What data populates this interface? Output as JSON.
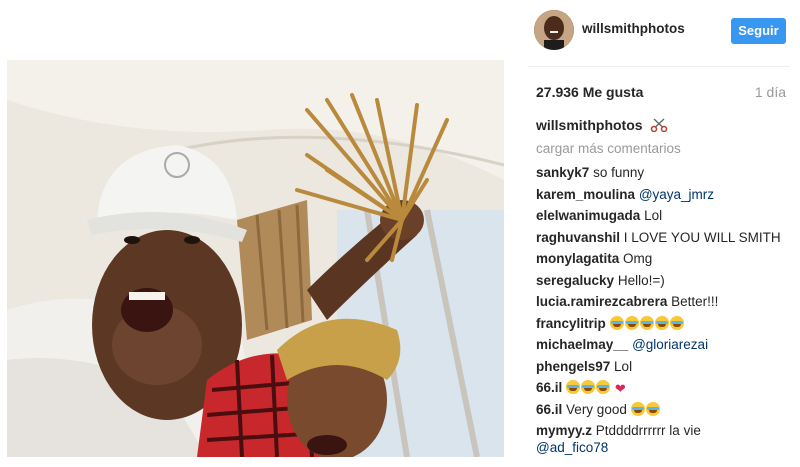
{
  "post": {
    "owner": "willsmithphotos",
    "follow_label": "Seguir",
    "likes": "27.936 Me gusta",
    "time": "1 día",
    "caption_user": "willsmithphotos",
    "caption_icon": "scissors-icon",
    "load_more": "cargar más comentarios"
  },
  "comments": [
    {
      "user": "sankyk7",
      "text": "so funny",
      "mention": ""
    },
    {
      "user": "karem_moulina",
      "text": "",
      "mention": "@yaya_jmrz"
    },
    {
      "user": "elelwanimugada",
      "text": "Lol",
      "mention": ""
    },
    {
      "user": "raghuvanshil",
      "text": "I LOVE YOU WILL SMITH",
      "mention": ""
    },
    {
      "user": "monylagatita",
      "text": "Omg",
      "mention": ""
    },
    {
      "user": "seregalucky",
      "text": "Hello!=)",
      "mention": ""
    },
    {
      "user": "lucia.ramirezcabrera",
      "text": "Better!!!",
      "mention": ""
    },
    {
      "user": "francylitrip",
      "text": "",
      "mention": ""
    },
    {
      "user": "michaelmay__",
      "text": "",
      "mention": "@gloriarezai"
    },
    {
      "user": "phengels97",
      "text": "Lol",
      "mention": ""
    },
    {
      "user": "66.il",
      "text": "",
      "mention": ""
    },
    {
      "user": "66.il",
      "text": "Very good",
      "mention": ""
    },
    {
      "user": "mymyy.z",
      "text": "Ptddddrrrrrr la vie",
      "mention": "@ad_fico78"
    }
  ],
  "colors": {
    "accent": "#3897f0",
    "mention": "#003569",
    "muted": "#999999"
  }
}
